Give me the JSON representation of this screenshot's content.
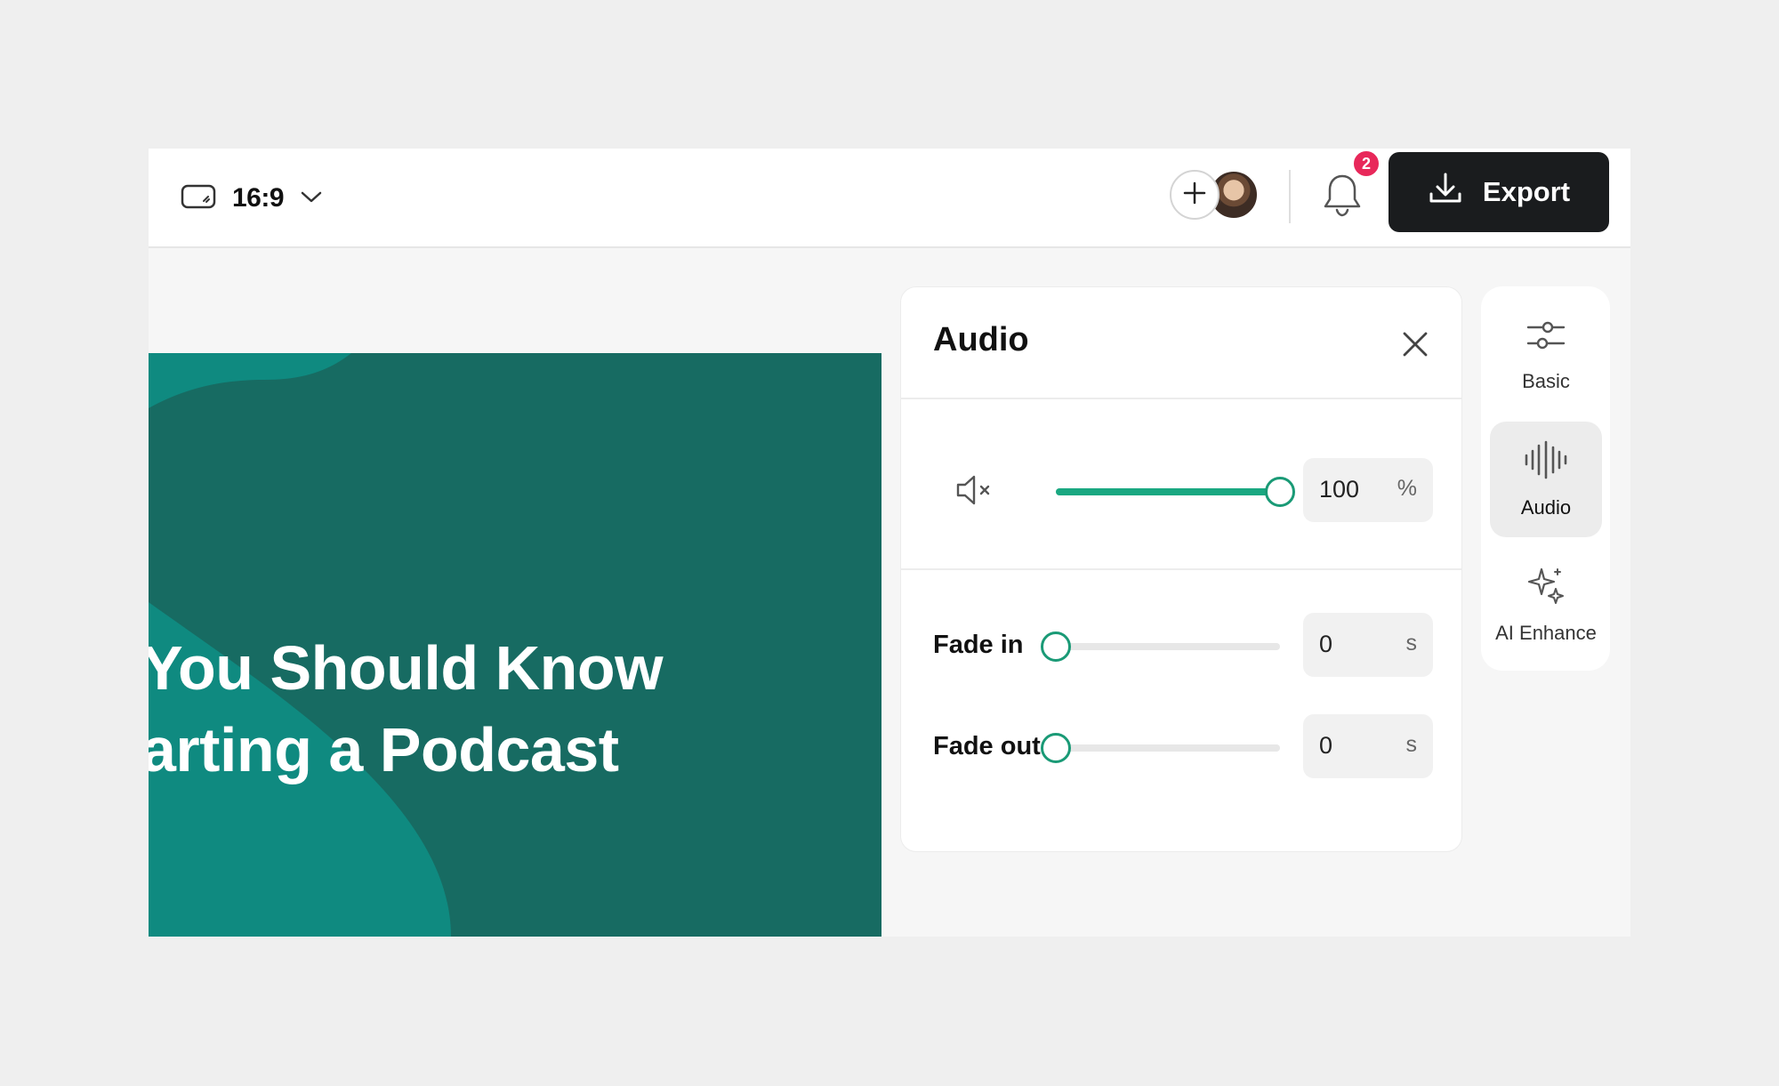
{
  "toolbar": {
    "aspect_ratio": "16:9",
    "notification_count": "2",
    "export_label": "Export"
  },
  "canvas": {
    "headline_line1": "You Should Know",
    "headline_line2": "arting a Podcast",
    "background_color": "#176b62",
    "accent_color": "#0f8a80"
  },
  "audio_panel": {
    "title": "Audio",
    "volume": {
      "value": "100",
      "unit": "%",
      "level": 1.0
    },
    "fade_in": {
      "label": "Fade in",
      "value": "0",
      "unit": "s",
      "level": 0
    },
    "fade_out": {
      "label": "Fade out",
      "value": "0",
      "unit": "s",
      "level": 0
    },
    "accent_color": "#1aa881"
  },
  "rail": {
    "items": [
      {
        "label": "Basic",
        "icon": "sliders-icon",
        "active": false
      },
      {
        "label": "Audio",
        "icon": "waveform-icon",
        "active": true
      },
      {
        "label": "AI Enhance",
        "icon": "sparkle-icon",
        "active": false
      }
    ]
  }
}
